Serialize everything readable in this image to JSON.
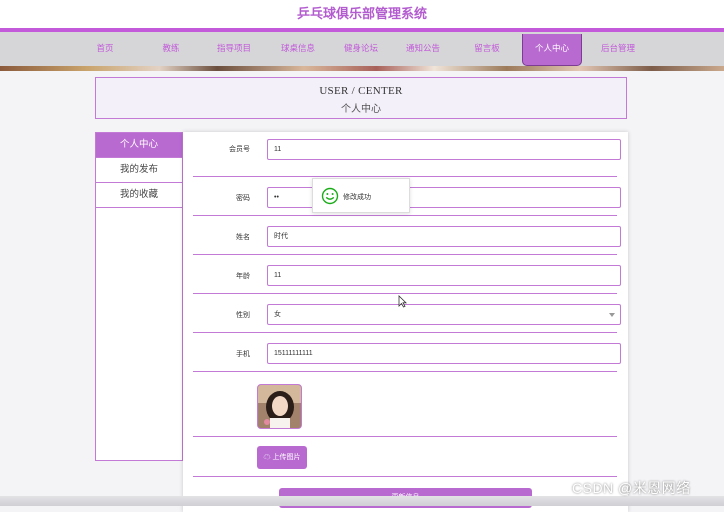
{
  "site": {
    "title": "乒乓球俱乐部管理系统"
  },
  "nav": {
    "items": [
      "首页",
      "教练",
      "指导项目",
      "球桌信息",
      "健身论坛",
      "通知公告",
      "留言板",
      "个人中心",
      "后台管理"
    ],
    "active_index": 7
  },
  "page_header": {
    "title_en": "USER / CENTER",
    "title_cn": "个人中心"
  },
  "sidebar": {
    "items": [
      "个人中心",
      "我的发布",
      "我的收藏"
    ],
    "active_index": 0
  },
  "form": {
    "member_no": {
      "label": "会员号",
      "value": "11"
    },
    "password": {
      "label": "密码",
      "value": "••"
    },
    "name": {
      "label": "姓名",
      "value": "时代"
    },
    "age": {
      "label": "年龄",
      "value": "11"
    },
    "gender": {
      "label": "性别",
      "value": "女"
    },
    "phone": {
      "label": "手机",
      "value": "15111111111"
    },
    "upload_label": "上传图片",
    "submit_label": "更新信息"
  },
  "toast": {
    "message": "修改成功"
  },
  "watermark": "CSDN @米恩网络",
  "colors": {
    "accent": "#b86ad1",
    "border": "#c27ad6",
    "title": "#b35ccf",
    "nav_bg": "#d6d6d9",
    "success": "#1aad19"
  }
}
